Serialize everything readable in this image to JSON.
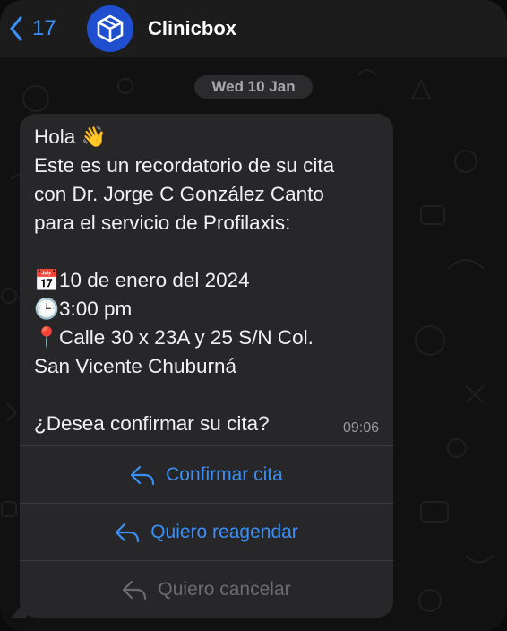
{
  "header": {
    "back_count": "17",
    "title": "Clinicbox",
    "avatar_icon": "cube-logo-icon"
  },
  "date_separator": "Wed 10 Jan",
  "message": {
    "lines": [
      "Hola 👋",
      "Este es un recordatorio de su cita",
      "con Dr. Jorge C González Canto",
      "para el servicio de Profilaxis:"
    ],
    "date_line": "10 de enero del 2024",
    "time_line": "3:00 pm",
    "address_line1": "Calle 30 x 23A y 25 S/N Col.",
    "address_line2": "San Vicente Chuburná",
    "question": "¿Desea confirmar su cita?",
    "timestamp": "09:06"
  },
  "actions": [
    {
      "label": "Confirmar cita",
      "icon": "reply-icon",
      "enabled": true
    },
    {
      "label": "Quiero reagendar",
      "icon": "reply-icon",
      "enabled": true
    },
    {
      "label": "Quiero cancelar",
      "icon": "reply-icon",
      "enabled": false
    }
  ],
  "colors": {
    "accent": "#3b8ff5",
    "bubble": "#27272a",
    "header": "#1c1c1d",
    "avatar": "#1f4fcf"
  }
}
